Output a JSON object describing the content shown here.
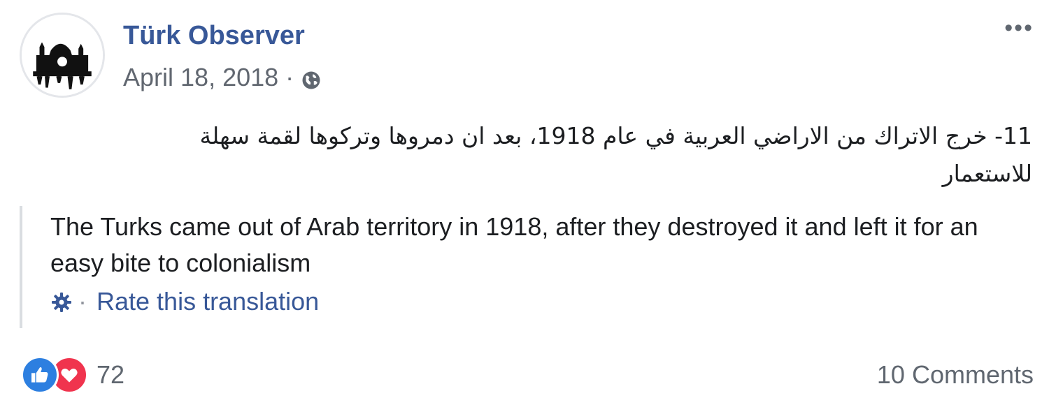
{
  "post": {
    "author": "Türk Observer",
    "date": "April 18, 2018",
    "separator": "·",
    "audience_icon": "globe-icon",
    "more_label": "•••",
    "text_arabic": "11- خرج الاتراك من الاراضي العربية في عام 1918، بعد ان دمروها وتركوها لقمة سهلة للاستعمار",
    "translation": {
      "text": "The Turks came out of Arab territory in 1918, after they destroyed it and left it for an easy bite to colonialism",
      "rate_separator": "·",
      "rate_label": "Rate this translation"
    }
  },
  "footer": {
    "reactions": [
      "like-icon",
      "love-icon"
    ],
    "reaction_count": "72",
    "comments_label": "10 Comments"
  },
  "colors": {
    "author": "#385898",
    "muted": "#606770",
    "like": "#2d7fe0",
    "love": "#f0344e",
    "quote_border": "#dadde1"
  }
}
